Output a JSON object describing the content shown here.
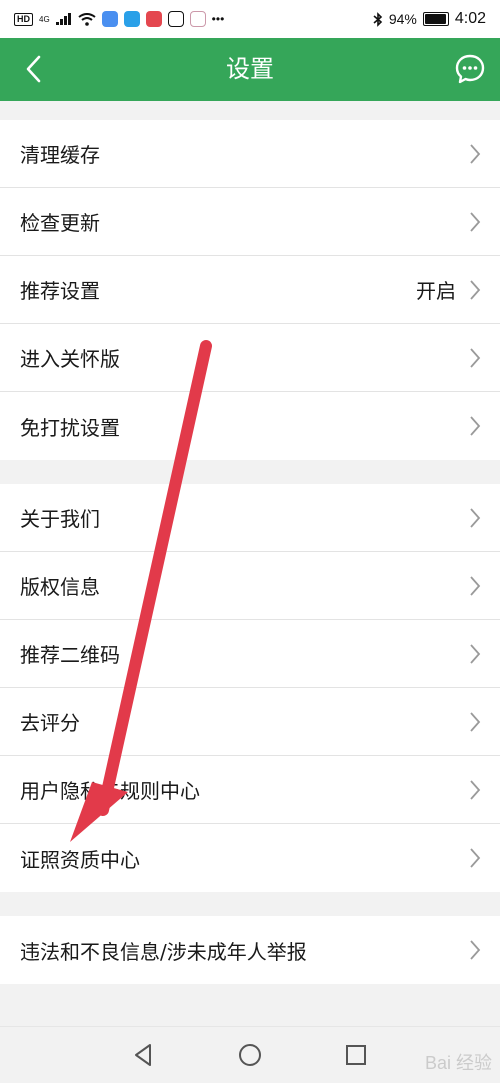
{
  "status_bar": {
    "hd": "HD",
    "network": "4G",
    "battery_text": "94%",
    "time": "4:02"
  },
  "header": {
    "title": "设置",
    "back_icon": "chevron-left-icon",
    "message_icon": "chat-bubble-icon",
    "background": "#35a659"
  },
  "groups": [
    {
      "items": [
        {
          "label": "清理缓存",
          "value": ""
        },
        {
          "label": "检查更新",
          "value": ""
        },
        {
          "label": "推荐设置",
          "value": "开启"
        },
        {
          "label": "进入关怀版",
          "value": ""
        },
        {
          "label": "免打扰设置",
          "value": ""
        }
      ]
    },
    {
      "items": [
        {
          "label": "关于我们",
          "value": ""
        },
        {
          "label": "版权信息",
          "value": ""
        },
        {
          "label": "推荐二维码",
          "value": ""
        },
        {
          "label": "去评分",
          "value": ""
        },
        {
          "label": "用户隐私与规则中心",
          "value": ""
        },
        {
          "label": "证照资质中心",
          "value": ""
        }
      ]
    },
    {
      "items": [
        {
          "label": "违法和不良信息/涉未成年人举报",
          "value": ""
        }
      ]
    }
  ],
  "annotation": {
    "color": "#e23a4a"
  },
  "watermark": "Bai 经验"
}
